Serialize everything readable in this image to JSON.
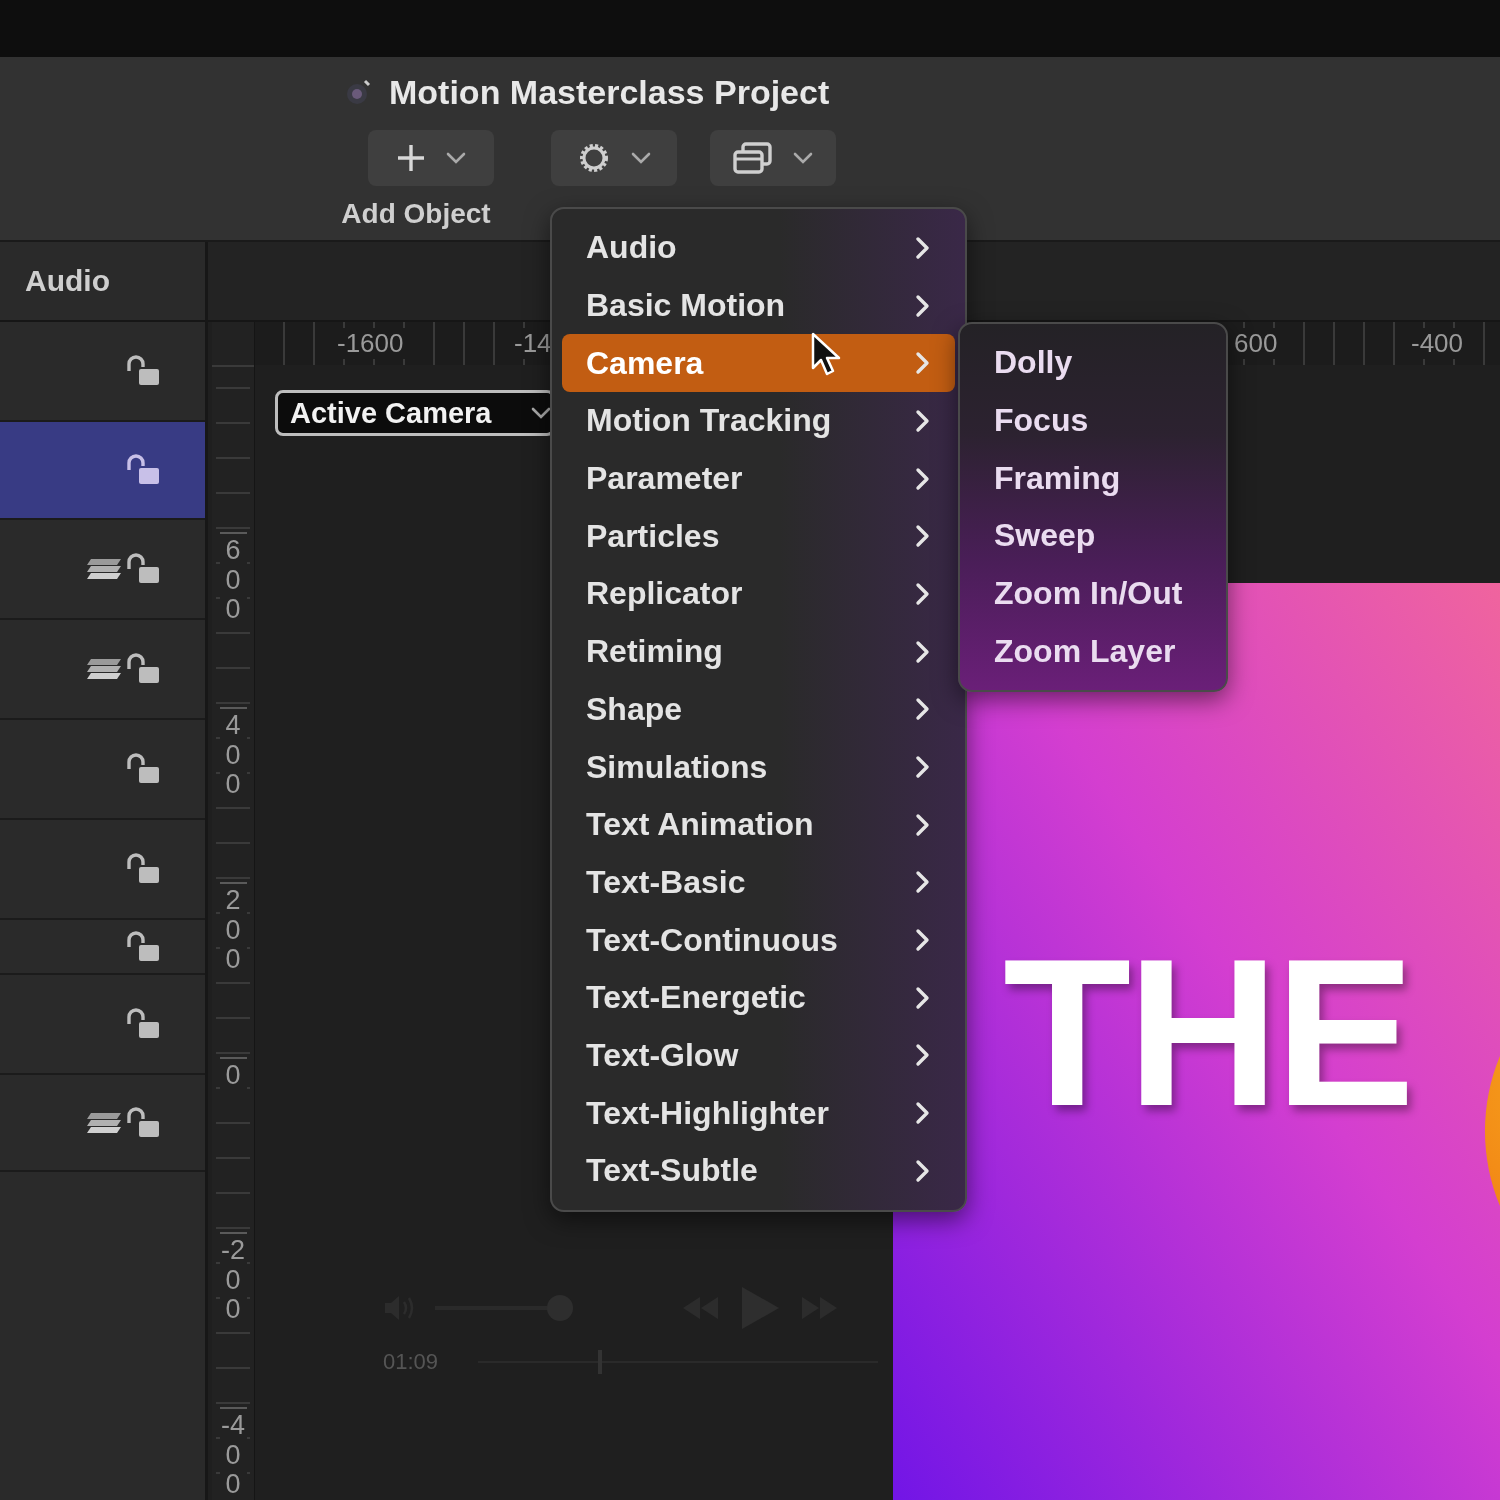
{
  "window": {
    "title": "Motion Masterclass Project"
  },
  "toolbar": {
    "buttons": [
      {
        "kind": "add",
        "label": "Add Object"
      },
      {
        "kind": "behaviors"
      },
      {
        "kind": "windows"
      }
    ]
  },
  "layers_panel": {
    "header": "Audio",
    "rows": [
      {
        "selected": false,
        "group": false
      },
      {
        "selected": true,
        "group": false
      },
      {
        "selected": false,
        "group": true
      },
      {
        "selected": false,
        "group": true
      },
      {
        "selected": false,
        "group": false
      },
      {
        "selected": false,
        "group": false
      },
      {
        "selected": false,
        "group": false
      },
      {
        "selected": false,
        "group": false
      },
      {
        "selected": false,
        "group": true
      }
    ]
  },
  "rulers": {
    "horizontal": [
      "-1600",
      "-14",
      "600",
      "-400"
    ],
    "vertical": [
      "600",
      "400",
      "200",
      "0",
      "-200",
      "-400"
    ]
  },
  "camera_menu": {
    "value": "Active Camera"
  },
  "menu": {
    "items": [
      {
        "label": "Audio",
        "selected": false
      },
      {
        "label": "Basic Motion",
        "selected": false
      },
      {
        "label": "Camera",
        "selected": true
      },
      {
        "label": "Motion Tracking",
        "selected": false
      },
      {
        "label": "Parameter",
        "selected": false
      },
      {
        "label": "Particles",
        "selected": false
      },
      {
        "label": "Replicator",
        "selected": false
      },
      {
        "label": "Retiming",
        "selected": false
      },
      {
        "label": "Shape",
        "selected": false
      },
      {
        "label": "Simulations",
        "selected": false
      },
      {
        "label": "Text Animation",
        "selected": false
      },
      {
        "label": "Text-Basic",
        "selected": false
      },
      {
        "label": "Text-Continuous",
        "selected": false
      },
      {
        "label": "Text-Energetic",
        "selected": false
      },
      {
        "label": "Text-Glow",
        "selected": false
      },
      {
        "label": "Text-Highlighter",
        "selected": false
      },
      {
        "label": "Text-Subtle",
        "selected": false
      }
    ]
  },
  "submenu": {
    "items": [
      {
        "label": "Dolly",
        "selected": false
      },
      {
        "label": "Focus",
        "selected": false
      },
      {
        "label": "Framing",
        "selected": false
      },
      {
        "label": "Sweep",
        "selected": false
      },
      {
        "label": "Zoom In/Out",
        "selected": false
      },
      {
        "label": "Zoom Layer",
        "selected": false
      }
    ]
  },
  "canvas": {
    "text": "THE"
  },
  "playback": {
    "volume": {
      "level": 1.0
    },
    "time": "01:09",
    "scrubber": {
      "level": 0.3
    }
  }
}
